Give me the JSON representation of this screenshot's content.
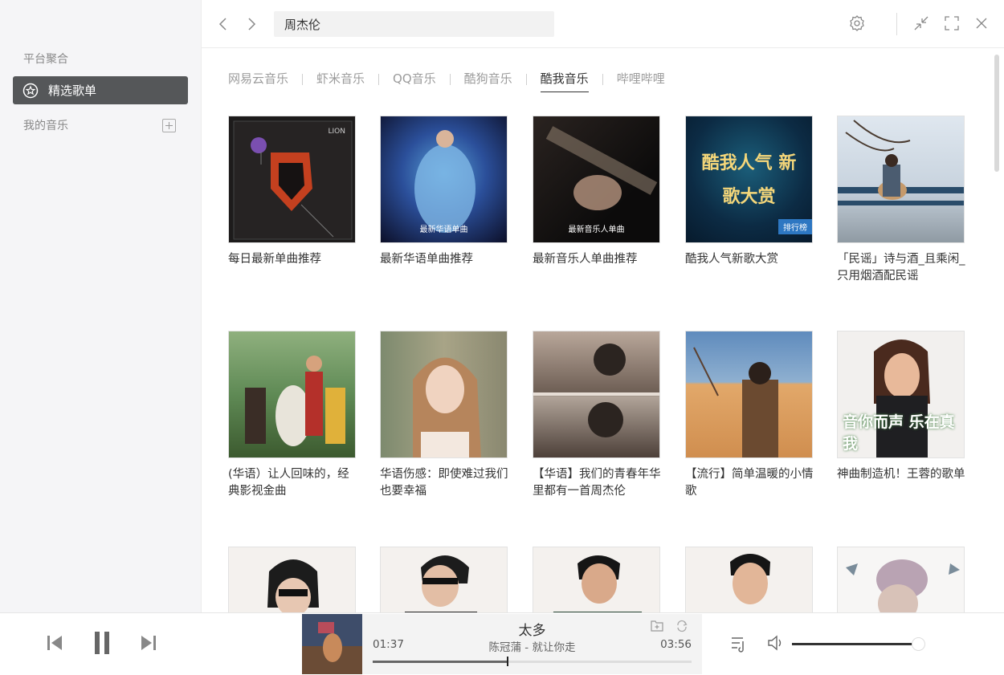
{
  "sidebar": {
    "section_title": "平台聚合",
    "active_item": "精选歌单",
    "my_music": "我的音乐"
  },
  "search": {
    "value": "周杰伦"
  },
  "tabs": [
    {
      "label": "网易云音乐",
      "active": false
    },
    {
      "label": "虾米音乐",
      "active": false
    },
    {
      "label": "QQ音乐",
      "active": false
    },
    {
      "label": "酷狗音乐",
      "active": false
    },
    {
      "label": "酷我音乐",
      "active": true
    },
    {
      "label": "哔哩哔哩",
      "active": false
    }
  ],
  "playlists": [
    {
      "title": "每日最新单曲推荐",
      "cover_text": "LION"
    },
    {
      "title": "最新华语单曲推荐",
      "cover_text": "最新华语单曲"
    },
    {
      "title": "最新音乐人单曲推荐",
      "cover_text": "最新音乐人单曲"
    },
    {
      "title": "酷我人气新歌大赏",
      "cover_text": "酷我人气 新歌大赏",
      "cover_badge": "排行榜"
    },
    {
      "title": "「民谣」诗与酒_且乘闲_只用烟酒配民谣"
    },
    {
      "title": "(华语）让人回味的，经典影视金曲"
    },
    {
      "title": "华语伤感：即使难过我们也要幸福"
    },
    {
      "title": "【华语】我们的青春年华里都有一首周杰伦"
    },
    {
      "title": "【流行】简单温暖的小情歌"
    },
    {
      "title": "神曲制造机！王蓉的歌单",
      "cover_text": "音你而声 乐在真我"
    },
    {
      "title": ""
    },
    {
      "title": ""
    },
    {
      "title": ""
    },
    {
      "title": ""
    },
    {
      "title": ""
    }
  ],
  "player": {
    "song": "太多",
    "artist_album": "陈冠蒲 - 就让你走",
    "elapsed": "01:37",
    "duration": "03:56",
    "progress": 0.42,
    "volume": 0.95
  },
  "colors": {
    "sidebar_active_bg": "#555759",
    "accent": "#333333"
  }
}
